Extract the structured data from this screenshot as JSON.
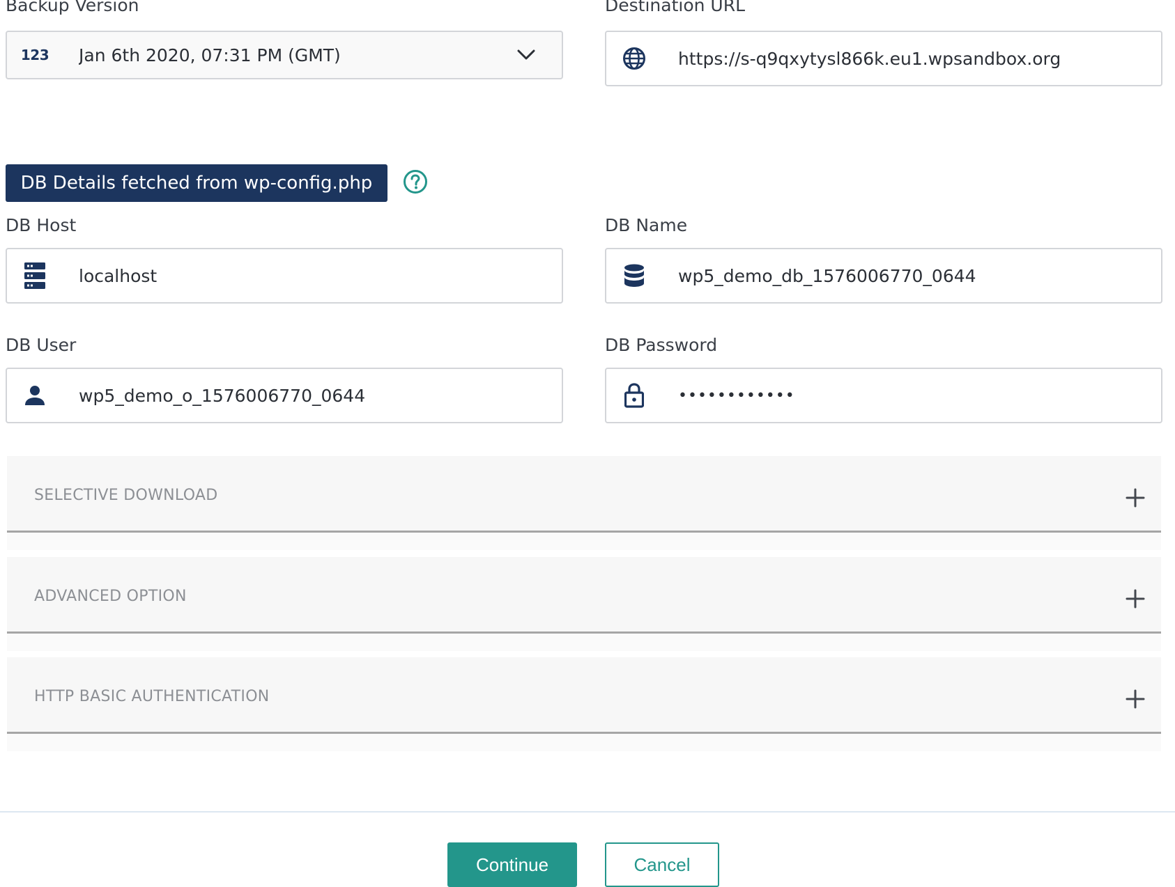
{
  "backup_version": {
    "label": "Backup Version",
    "icon_text": "123",
    "value": "Jan 6th 2020, 07:31 PM (GMT)"
  },
  "destination_url": {
    "label": "Destination URL",
    "value": "https://s-q9qxytysl866k.eu1.wpsandbox.org"
  },
  "db_badge": {
    "text": "DB Details fetched from wp-config.php"
  },
  "db_host": {
    "label": "DB Host",
    "value": "localhost"
  },
  "db_name": {
    "label": "DB Name",
    "value": "wp5_demo_db_1576006770_0644"
  },
  "db_user": {
    "label": "DB User",
    "value": "wp5_demo_o_1576006770_0644"
  },
  "db_password": {
    "label": "DB Password",
    "value": "••••••••••••"
  },
  "accordions": [
    {
      "title": "SELECTIVE DOWNLOAD"
    },
    {
      "title": "ADVANCED OPTION"
    },
    {
      "title": "HTTP BASIC AUTHENTICATION"
    }
  ],
  "buttons": {
    "continue": "Continue",
    "cancel": "Cancel"
  },
  "colors": {
    "navy": "#1c355e",
    "teal": "#23968b",
    "accordion_bg": "#f7f7f7"
  },
  "icons": {
    "backup_version": "number-123-icon",
    "destination_url": "globe-icon",
    "help": "help-circle-icon",
    "db_host": "server-icon",
    "db_name": "database-icon",
    "db_user": "user-icon",
    "db_password": "lock-icon",
    "dropdown": "chevron-down-icon",
    "accordion_toggle": "plus-icon"
  }
}
